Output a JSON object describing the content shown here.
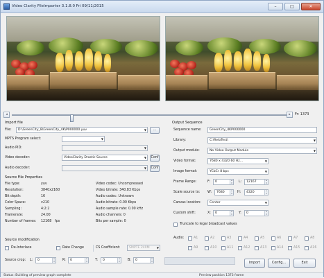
{
  "window": {
    "title": "Video Clarity FileImporter 3.1.8.0 Fri 09/11/2015",
    "controls": [
      "minimize",
      "maximize",
      "close"
    ]
  },
  "seek": {
    "frame_label": "Fr: 1373",
    "position_fraction": 0.21
  },
  "import": {
    "header": "Import file",
    "file_label": "File:",
    "file_value": "D:\\GreenCity_8\\GreenCity_4K\\P000000.yuv",
    "browse_label": "...",
    "mpts_label": "MPTS Program select:",
    "mpts_value": "",
    "audio_pid_label": "Audio PID:",
    "audio_pid_value": "",
    "video_decoder_label": "Video decoder:",
    "video_decoder_value": "VideoClarity Drastic Source",
    "conf_label": "Conf",
    "audio_decoder_label": "Audio decoder:",
    "audio_decoder_value": ""
  },
  "source_props": {
    "header": "Source File Properties",
    "left": [
      {
        "k": "File type:",
        "v": "yuv"
      },
      {
        "k": "Resolution:",
        "v": "3840x2160"
      },
      {
        "k": "Bit depth:",
        "v": "16"
      },
      {
        "k": "Color Space:",
        "v": "v210"
      },
      {
        "k": "Sampling:",
        "v": "4:2:2"
      },
      {
        "k": "Framerate:",
        "v": "24.00"
      },
      {
        "k": "Number of frames:",
        "v": "12168"
      }
    ],
    "fps_unit": "fps",
    "right": [
      "Video codec: Uncompressed",
      "Video bitrate: 340.83 Kbps",
      "Audio codec: Unknown",
      "Audio bitrate: 0.00 Kbps",
      "Audio sample rate: 0.00 kHz",
      "Audio channels: 0",
      "Bits per sample: 0"
    ]
  },
  "source_mod": {
    "header": "Source modification",
    "deinterlace": "De-Interlace",
    "rate_change": "Rate Change",
    "csc_label": "CS Coefficient:",
    "csc_value": "SMPTE 240M",
    "crop_label": "Source crop:",
    "crop": [
      {
        "k": "L:",
        "v": "0"
      },
      {
        "k": "R:",
        "v": "0"
      },
      {
        "k": "T:",
        "v": "0"
      },
      {
        "k": "B:",
        "v": "0"
      }
    ]
  },
  "output": {
    "header": "Output Sequence",
    "seq_name_label": "Sequence name:",
    "seq_name_value": "GreenCity_4KP000000",
    "library_label": "Library:",
    "library_value": "C:\\ReloTest\\",
    "module_label": "Output module:",
    "module_value": "No Video Output Module",
    "vformat_label": "Video format:",
    "vformat_value": "7680 x 4320 60 Hz...",
    "iformat_label": "Image format:",
    "iformat_value": "YCbCr 8 bpc",
    "frange_label": "Frame Range:",
    "f_label": "F:",
    "f_value": "0",
    "l_label": "L:",
    "l_value": "12167",
    "scale_label": "Scale source to:",
    "w_label": "W:",
    "w_value": "7680",
    "h_label": "H:",
    "h_value": "4320",
    "canvas_label": "Canvas location:",
    "canvas_value": "Center",
    "shift_label": "Custom shift:",
    "x_label": "X:",
    "x_value": "0",
    "y_label": "Y:",
    "y_value": "0",
    "truncate_label": "Truncate to legal broadcast values",
    "audio_label": "Audio:",
    "audio_row1": [
      "A1",
      "A2",
      "A3",
      "A4",
      "A5",
      "A6",
      "A7",
      "A8"
    ],
    "audio_row2": [
      "A9",
      "A10",
      "A11",
      "A12",
      "A13",
      "A14",
      "A15",
      "A16"
    ]
  },
  "actions": {
    "import": "Import",
    "config": "Config...",
    "exit": "Exit"
  },
  "status": {
    "left": "Status: Building of preview graph complete",
    "right": "Preview position 1373 frame"
  }
}
